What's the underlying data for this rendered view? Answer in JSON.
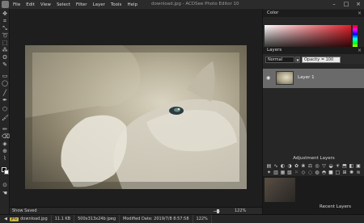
{
  "titlebar": {
    "menu": [
      "File",
      "Edit",
      "View",
      "Select",
      "Filter",
      "Layer",
      "Tools",
      "Help"
    ],
    "document_title": "download.jpg - ACDSee Photo Editor 10",
    "minimize_glyph": "–",
    "maximize_glyph": "□",
    "close_glyph": "×"
  },
  "tools": {
    "icons": [
      "move-icon",
      "crop-icon",
      "transform-icon",
      "lasso-icon",
      "selection-icon",
      "magic-wand-icon",
      "rectangle-select-icon",
      "ellipse-select-icon",
      "line-icon",
      "pen-icon",
      "shape-icon",
      "brush-icon",
      "pencil-icon",
      "eraser-icon",
      "fill-icon",
      "clone-icon",
      "gradient-icon",
      "text-icon",
      "eyedropper-icon",
      "zoom-icon",
      "hand-icon"
    ]
  },
  "colors": {
    "foreground": "#000000",
    "background": "#ffffff",
    "accent": "#5e8ab5",
    "layer_selected": "#6a6a6a"
  },
  "canvas_bar": {
    "show_saved": "Show Saved",
    "zoom_value": "122%"
  },
  "panels": {
    "color_title": "Color",
    "layers_title": "Layers",
    "blend_mode": "Normal",
    "opacity": "Opacity = 100",
    "layer_name": "Layer 1",
    "adjustment_title": "Adjustment Layers",
    "recent_title": "Recent Layers"
  },
  "status": {
    "format": "JPG",
    "filename": "download.jpg",
    "filesize": "11.1 KB",
    "dimensions": "500x313x24b jpeg",
    "modified": "Modified Date: 2019/7/8 8:57:58",
    "zoom": "122%"
  }
}
